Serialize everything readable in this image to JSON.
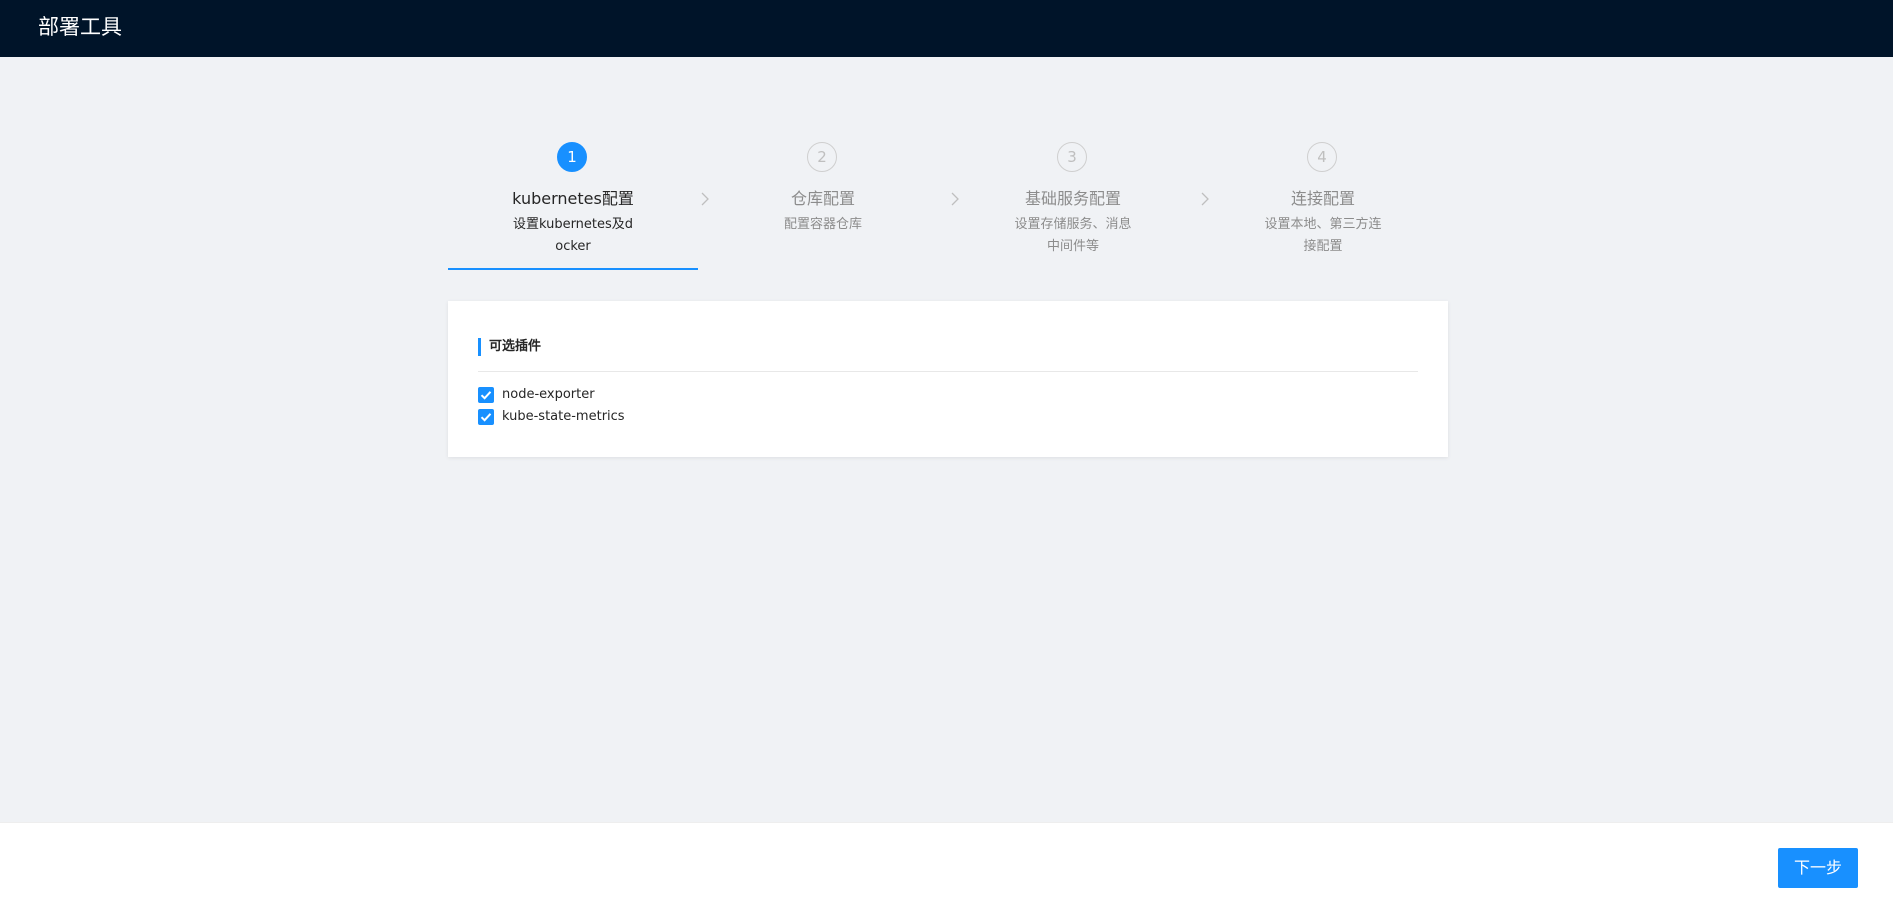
{
  "header": {
    "title": "部署工具"
  },
  "steps": [
    {
      "number": "1",
      "title": "kubernetes配置",
      "description": "设置kubernetes及docker",
      "status": "active"
    },
    {
      "number": "2",
      "title": "仓库配置",
      "description": "配置容器仓库",
      "status": "wait"
    },
    {
      "number": "3",
      "title": "基础服务配置",
      "description": "设置存储服务、消息中间件等",
      "status": "wait"
    },
    {
      "number": "4",
      "title": "连接配置",
      "description": "设置本地、第三方连接配置",
      "status": "wait"
    }
  ],
  "plugins": {
    "title": "可选插件",
    "items": [
      {
        "label": "node-exporter",
        "checked": true
      },
      {
        "label": "kube-state-metrics",
        "checked": true
      }
    ]
  },
  "footer": {
    "next_label": "下一步"
  },
  "colors": {
    "header_bg": "#001429",
    "accent": "#1890ff",
    "page_bg": "#f0f2f5"
  }
}
